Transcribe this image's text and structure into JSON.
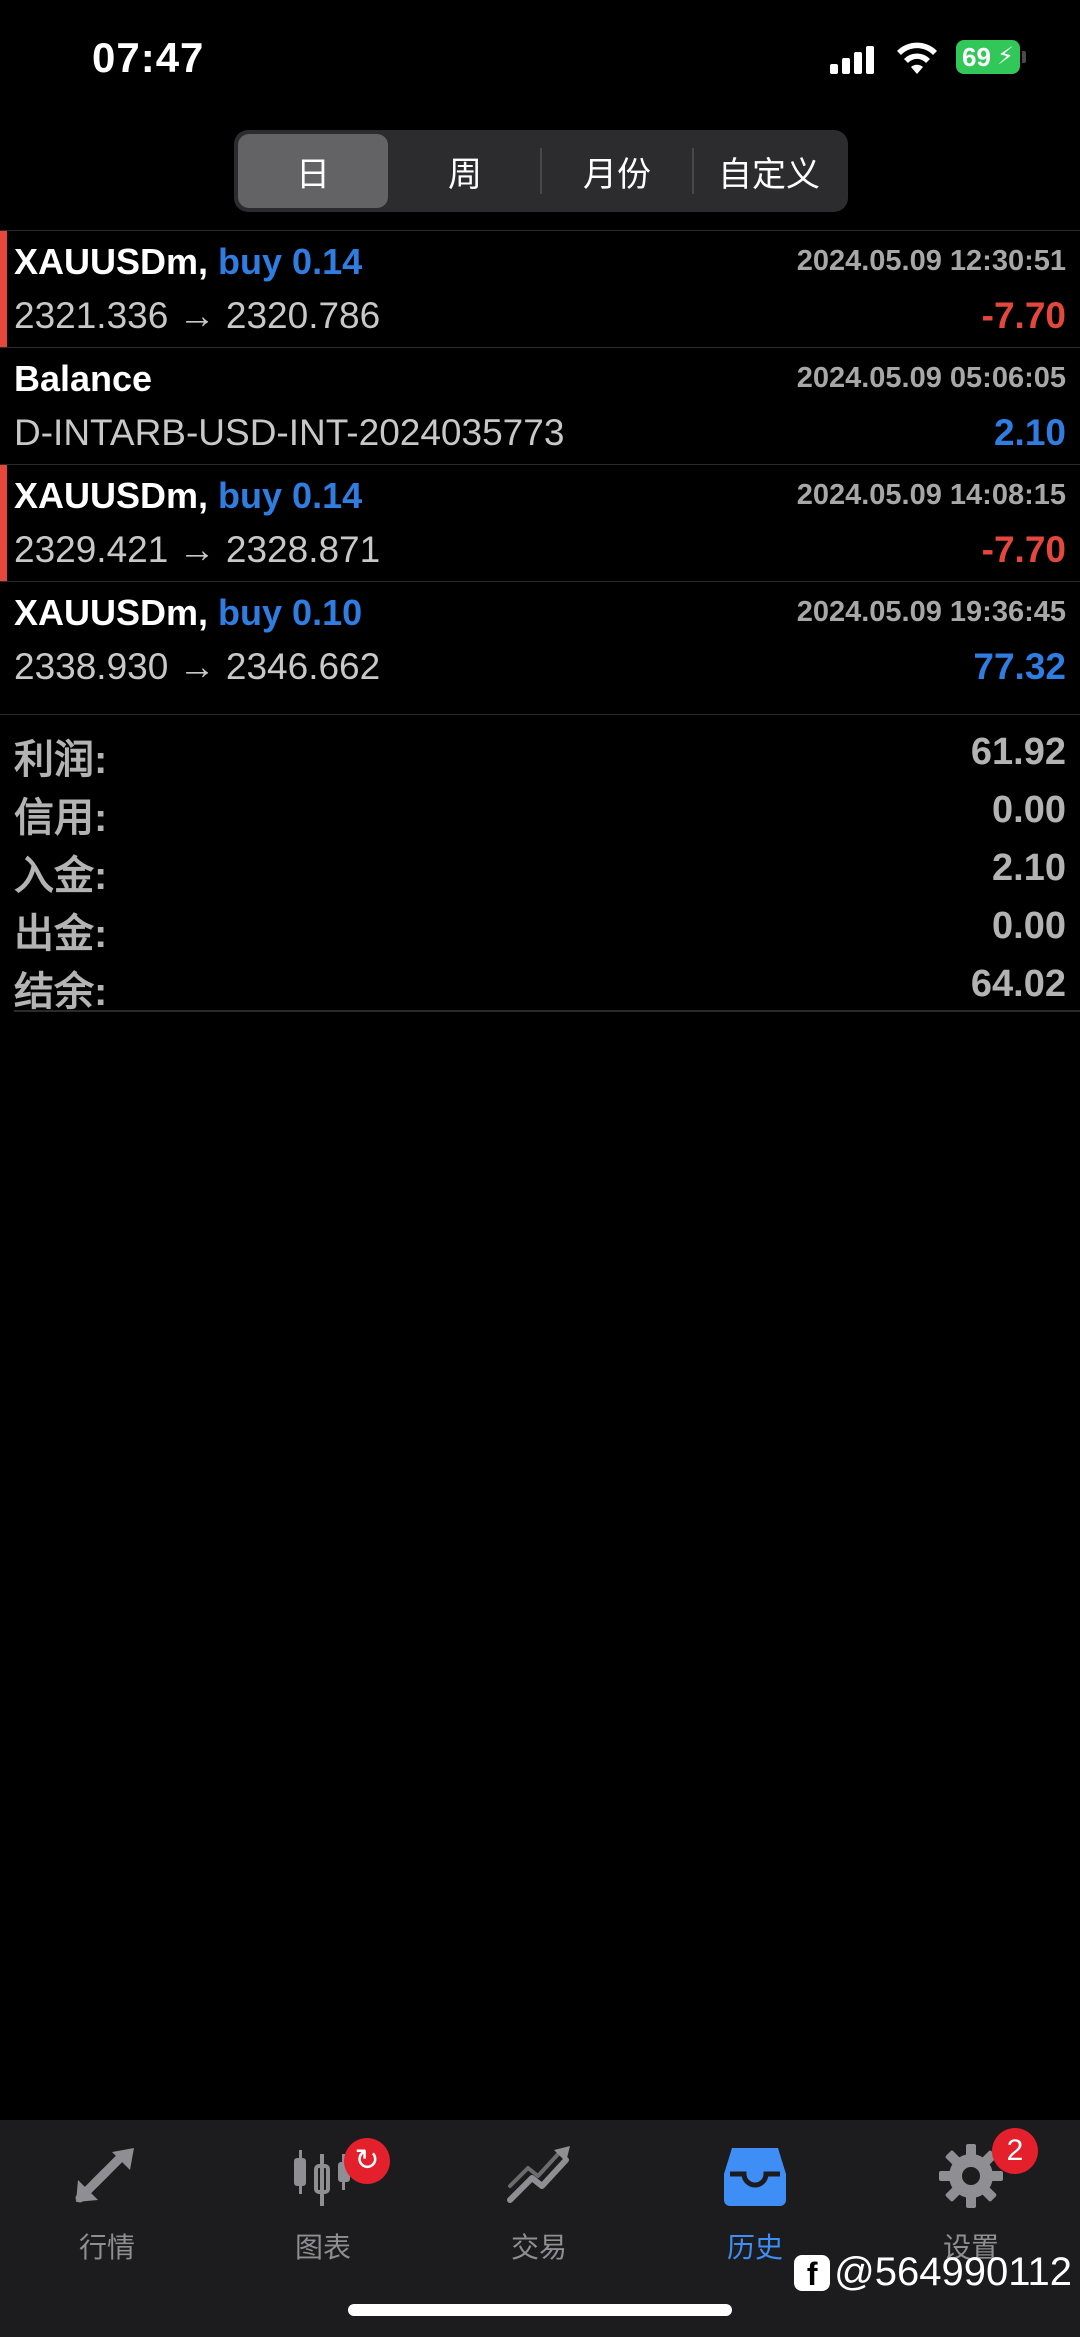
{
  "status_bar": {
    "time": "07:47",
    "battery": "69"
  },
  "segments": [
    {
      "label": "日",
      "active": true
    },
    {
      "label": "周",
      "active": false
    },
    {
      "label": "月份",
      "active": false
    },
    {
      "label": "自定义",
      "active": false
    }
  ],
  "trades": [
    {
      "symbol": "XAUUSDm,",
      "side": "buy 0.14",
      "timestamp": "2024.05.09 12:30:51",
      "prices": "2321.336 → 2320.786",
      "pl": "-7.70",
      "pl_sign": "neg",
      "loss_marker": true
    },
    {
      "symbol": "Balance",
      "side": "",
      "timestamp": "2024.05.09 05:06:05",
      "prices": "D-INTARB-USD-INT-2024035773",
      "pl": "2.10",
      "pl_sign": "pos",
      "loss_marker": false
    },
    {
      "symbol": "XAUUSDm,",
      "side": "buy 0.14",
      "timestamp": "2024.05.09 14:08:15",
      "prices": "2329.421 → 2328.871",
      "pl": "-7.70",
      "pl_sign": "neg",
      "loss_marker": true
    },
    {
      "symbol": "XAUUSDm,",
      "side": "buy 0.10",
      "timestamp": "2024.05.09 19:36:45",
      "prices": "2338.930 → 2346.662",
      "pl": "77.32",
      "pl_sign": "pos",
      "loss_marker": false
    }
  ],
  "summary": [
    {
      "label": "利润:",
      "value": "61.92"
    },
    {
      "label": "信用:",
      "value": "0.00"
    },
    {
      "label": "入金:",
      "value": "2.10"
    },
    {
      "label": "出金:",
      "value": "0.00"
    },
    {
      "label": "结余:",
      "value": "64.02"
    }
  ],
  "nav": [
    {
      "label": "行情",
      "icon": "quotes-arrows-icon",
      "active": false
    },
    {
      "label": "图表",
      "icon": "candlestick-chart-icon",
      "active": false,
      "badge_icon": "refresh-icon"
    },
    {
      "label": "交易",
      "icon": "trade-trend-icon",
      "active": false
    },
    {
      "label": "历史",
      "icon": "history-inbox-icon",
      "active": true
    },
    {
      "label": "设置",
      "icon": "gear-icon",
      "active": false,
      "badge": "2"
    }
  ],
  "watermark": "@564990112",
  "colors": {
    "loss": "#e5473d",
    "profit": "#2f7de1",
    "active_tab": "#3f8ef5"
  }
}
